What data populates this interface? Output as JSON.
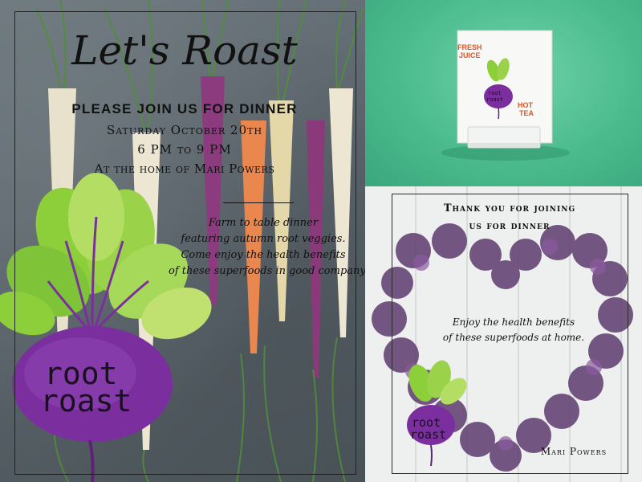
{
  "invite": {
    "title": "Let's Roast",
    "headline": "PLEASE JOIN US FOR DINNER",
    "date": "Saturday October 20th",
    "time": "6 PM to 9 PM",
    "location": "At the home of Mari Powers",
    "description": [
      "Farm to table dinner",
      "featuring autumn root veggies.",
      "Come enjoy the health benefits",
      "of these superfoods in good company"
    ],
    "logo": [
      "root",
      "roast"
    ]
  },
  "mockup": {
    "left_label": [
      "FRESH",
      "JUICE"
    ],
    "right_label": [
      "HOT",
      "TEA"
    ],
    "beet_label": [
      "root",
      "roast"
    ]
  },
  "thanks": {
    "heading": [
      "Thank you for joining",
      "us for dinner"
    ],
    "body": [
      "Enjoy the health benefits",
      "of these superfoods at home."
    ],
    "logo": [
      "root",
      "roast"
    ],
    "signature": "Mari Powers"
  },
  "colors": {
    "beet_purple": "#7b2f9e",
    "beet_leaf": "#8ccf3a",
    "carrot_orange": "#e9874f",
    "mint_background": "#4bbb8d"
  }
}
